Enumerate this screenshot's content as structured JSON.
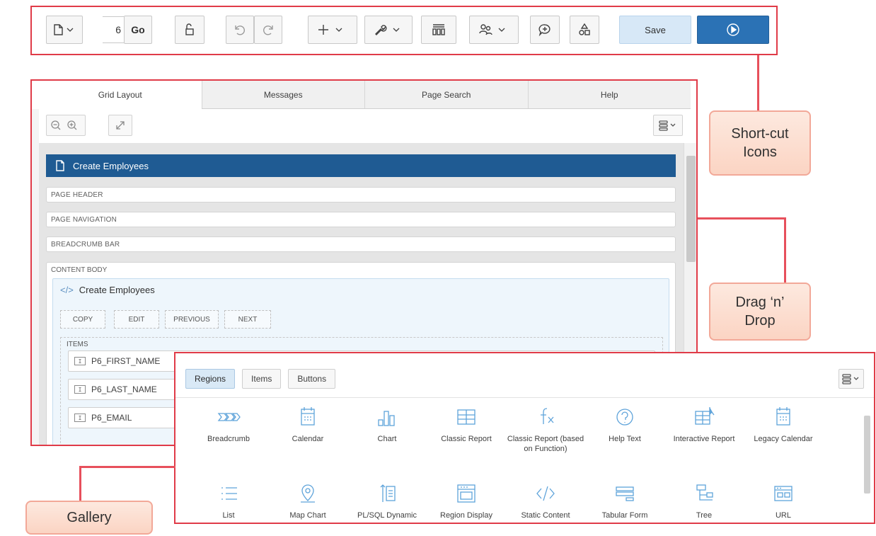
{
  "toolbar": {
    "page_number": "6",
    "go_label": "Go",
    "save_label": "Save"
  },
  "main": {
    "tabs": [
      "Grid Layout",
      "Messages",
      "Page Search",
      "Help"
    ],
    "page_title": "Create Employees",
    "slots": [
      "PAGE HEADER",
      "PAGE NAVIGATION",
      "BREADCRUMB BAR"
    ],
    "content_body_label": "CONTENT BODY",
    "region_title": "Create Employees",
    "region_buttons": [
      "COPY",
      "EDIT",
      "PREVIOUS",
      "NEXT"
    ],
    "items_label": "ITEMS",
    "items": [
      "P6_FIRST_NAME",
      "P6_LAST_NAME",
      "P6_EMAIL"
    ]
  },
  "gallery": {
    "tabs": [
      "Regions",
      "Items",
      "Buttons"
    ],
    "items": [
      {
        "label": "Breadcrumb",
        "icon": "breadcrumb-icon"
      },
      {
        "label": "Calendar",
        "icon": "calendar-icon"
      },
      {
        "label": "Chart",
        "icon": "bar-chart-icon"
      },
      {
        "label": "Classic Report",
        "icon": "table-icon"
      },
      {
        "label": "Classic Report (based on Function)",
        "icon": "function-icon"
      },
      {
        "label": "Help Text",
        "icon": "help-icon"
      },
      {
        "label": "Interactive Report",
        "icon": "interactive-report-icon"
      },
      {
        "label": "Legacy Calendar",
        "icon": "calendar-icon"
      },
      {
        "label": "List",
        "icon": "list-icon"
      },
      {
        "label": "Map Chart",
        "icon": "map-pin-icon"
      },
      {
        "label": "PL/SQL Dynamic",
        "icon": "plsql-icon"
      },
      {
        "label": "Region Display",
        "icon": "region-display-icon"
      },
      {
        "label": "Static Content",
        "icon": "code-icon"
      },
      {
        "label": "Tabular Form",
        "icon": "tabular-form-icon"
      },
      {
        "label": "Tree",
        "icon": "tree-icon"
      },
      {
        "label": "URL",
        "icon": "url-icon"
      }
    ]
  },
  "callouts": {
    "shortcut": "Short-cut Icons",
    "dragdrop": "Drag ‘n’ Drop",
    "gallery": "Gallery"
  },
  "colors": {
    "highlight_border": "#e03b48",
    "page_bar": "#1f5b93",
    "run_button": "#2b72b5",
    "save_button": "#d7e8f7",
    "gallery_icon": "#5ea3da",
    "callout_fill": "#fbd4c3"
  }
}
